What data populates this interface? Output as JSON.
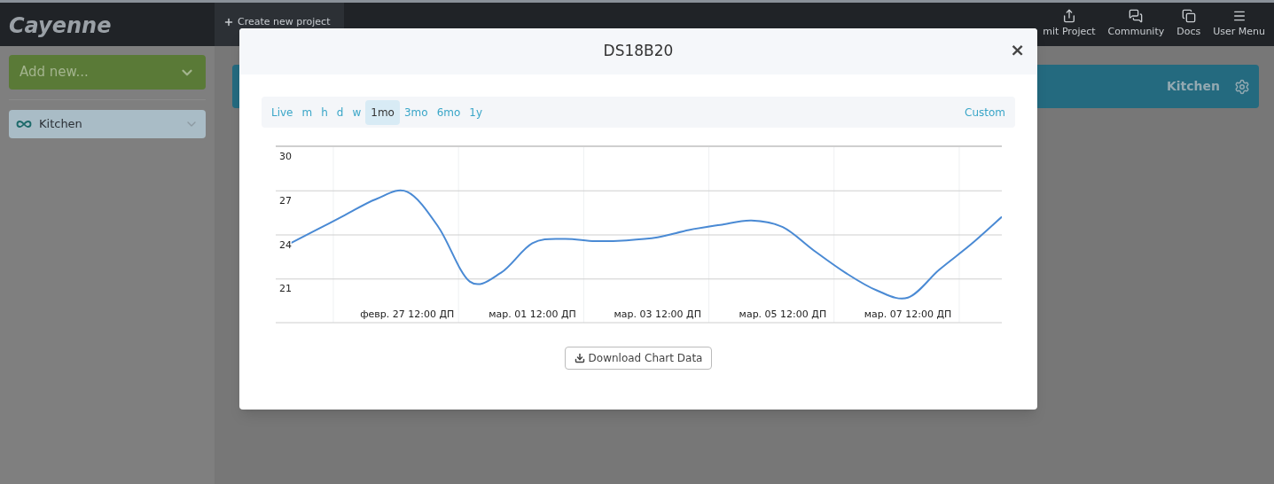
{
  "app": {
    "logo": "Cayenne"
  },
  "nav": {
    "create_project": "Create new project",
    "items": [
      {
        "label": "mit Project"
      },
      {
        "label": "Community"
      },
      {
        "label": "Docs"
      },
      {
        "label": "User Menu"
      }
    ]
  },
  "sidebar": {
    "add_new": "Add new...",
    "items": [
      {
        "label": "Kitchen"
      }
    ]
  },
  "project_header": {
    "title": "Kitchen"
  },
  "modal": {
    "title": "DS18B20",
    "close": "×",
    "ranges": [
      {
        "label": "Live",
        "selected": false
      },
      {
        "label": "m",
        "selected": false
      },
      {
        "label": "h",
        "selected": false
      },
      {
        "label": "d",
        "selected": false
      },
      {
        "label": "w",
        "selected": false
      },
      {
        "label": "1mo",
        "selected": true
      },
      {
        "label": "3mo",
        "selected": false
      },
      {
        "label": "6mo",
        "selected": false
      },
      {
        "label": "1y",
        "selected": false
      }
    ],
    "custom": "Custom",
    "chart_data": {
      "type": "line",
      "categories": [
        null,
        null,
        null,
        null,
        "февр. 27 12:00 ДП",
        null,
        null,
        null,
        "мар. 01 12:00 ДП",
        null,
        null,
        null,
        "мар. 03 12:00 ДП",
        null,
        null,
        null,
        "мар. 05 12:00 ДП",
        null,
        null,
        null,
        "мар. 07 12:00 ДП",
        null,
        null,
        null
      ],
      "series": [
        {
          "color": "#4a8ad4",
          "values": [
            23.1,
            24.2,
            25.3,
            26.4,
            26.9,
            24.5,
            20.8,
            21.4,
            23.4,
            23.7,
            23.55,
            23.6,
            23.8,
            24.3,
            24.65,
            24.95,
            24.5,
            22.9,
            21.4,
            20.2,
            19.7,
            21.6,
            23.3,
            25.2
          ]
        }
      ],
      "ylim": [
        18,
        30
      ],
      "grid": true,
      "yticks": [
        21,
        24,
        27,
        30
      ]
    },
    "download_button": "Download Chart Data"
  }
}
